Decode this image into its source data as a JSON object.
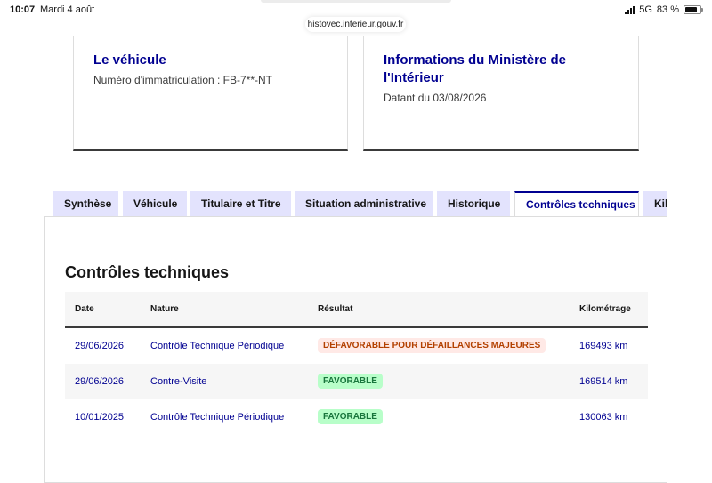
{
  "status_bar": {
    "time": "10:07",
    "date": "Mardi 4 août",
    "network": "5G",
    "battery": "83 %",
    "battery_level": 0.83
  },
  "browser": {
    "url": "histovec.interieur.gouv.fr"
  },
  "cards": {
    "vehicle": {
      "title": "Le véhicule",
      "text": "Numéro d'immatriculation : FB-7**-NT"
    },
    "ministry": {
      "title_line1": "Informations du Ministère de",
      "title_line2": "l'Intérieur",
      "text": "Datant du 03/08/2026"
    }
  },
  "tabs": [
    {
      "label": "Synthèse"
    },
    {
      "label": "Véhicule"
    },
    {
      "label": "Titulaire et Titre"
    },
    {
      "label": "Situation administrative"
    },
    {
      "label": "Historique"
    },
    {
      "label": "Contrôles techniques",
      "active": true
    },
    {
      "label": "Kilométrage"
    }
  ],
  "section": {
    "title": "Contrôles techniques",
    "headers": [
      "Date",
      "Nature",
      "Résultat",
      "Kilométrage"
    ],
    "rows": [
      {
        "date": "29/06/2026",
        "nature": "Contrôle Technique Périodique",
        "result": "DÉFAVORABLE POUR DÉFAILLANCES MAJEURES",
        "result_status": "bad",
        "km": "169493 km"
      },
      {
        "date": "29/06/2026",
        "nature": "Contre-Visite",
        "result": "FAVORABLE",
        "result_status": "good",
        "km": "169514 km"
      },
      {
        "date": "10/01/2025",
        "nature": "Contrôle Technique Périodique",
        "result": "FAVORABLE",
        "result_status": "good",
        "km": "130063 km"
      }
    ]
  },
  "colors": {
    "accent": "#000091",
    "tab_bg": "#e3e3fd",
    "bad_bg": "#ffe9e6",
    "bad_text": "#b34000",
    "good_bg": "#b8fec9",
    "good_text": "#18753c"
  }
}
